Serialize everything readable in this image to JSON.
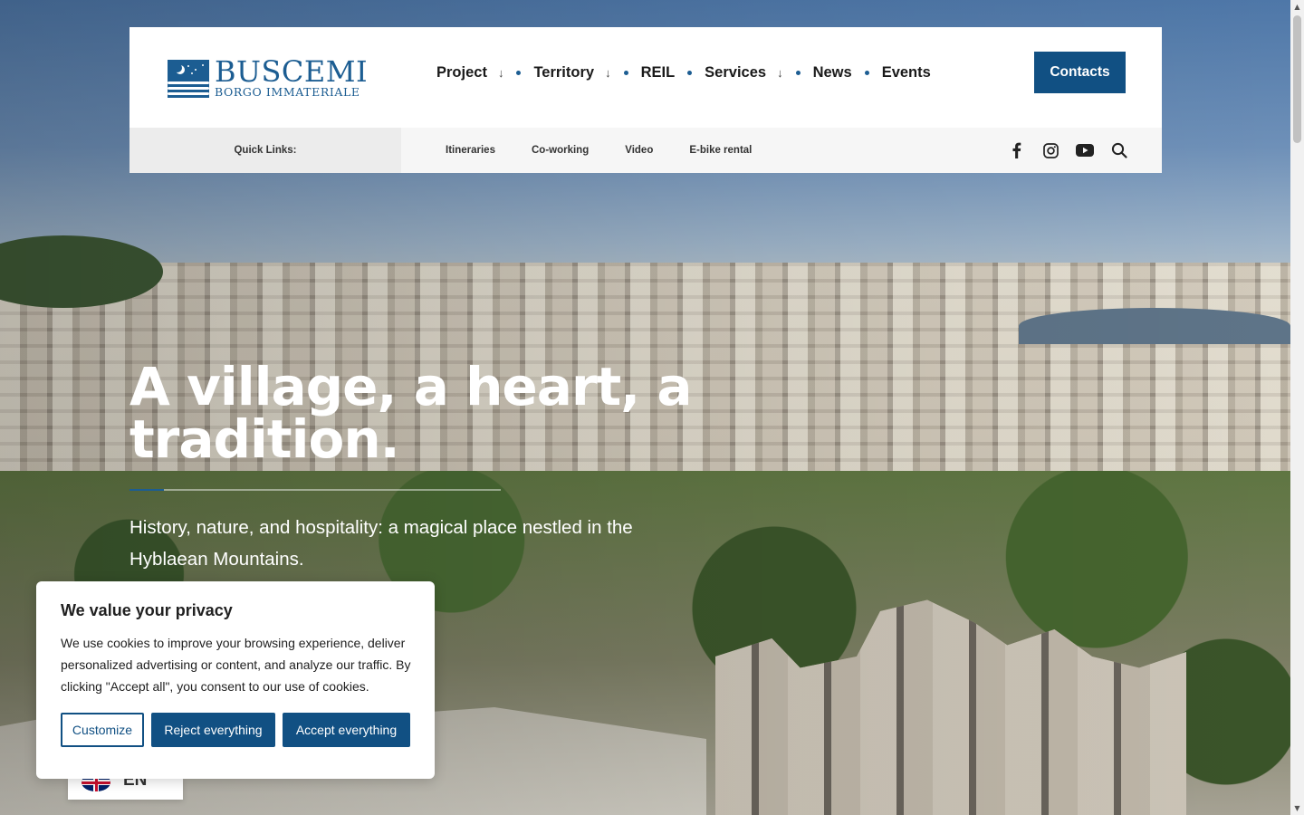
{
  "logo": {
    "title": "BUSCEMI",
    "subtitle": "BORGO IMMATERIALE"
  },
  "nav": {
    "items": [
      {
        "label": "Project",
        "has_dropdown": true
      },
      {
        "label": "Territory",
        "has_dropdown": true
      },
      {
        "label": "REIL",
        "has_dropdown": false
      },
      {
        "label": "Services",
        "has_dropdown": true
      },
      {
        "label": "News",
        "has_dropdown": false
      },
      {
        "label": "Events",
        "has_dropdown": false
      }
    ],
    "dropdown_glyph": "↓",
    "contacts_label": "Contacts"
  },
  "quick_links": {
    "label": "Quick Links:",
    "items": [
      "Itineraries",
      "Co-working",
      "Video",
      "E-bike rental"
    ]
  },
  "socials": [
    "facebook-icon",
    "instagram-icon",
    "youtube-icon",
    "search-icon"
  ],
  "hero": {
    "title": "A village, a heart, a tradition.",
    "subtitle": "History, nature, and hospitality: a magical place nestled in the Hyblaean Mountains."
  },
  "cookie": {
    "title": "We value your privacy",
    "text": "We use cookies to improve your browsing experience, deliver personalized advertising or content, and analyze our traffic. By clicking \"Accept all\", you consent to our use of cookies.",
    "customize_label": "Customize",
    "reject_label": "Reject everything",
    "accept_label": "Accept everything"
  },
  "language": {
    "code": "EN",
    "caret": "^"
  },
  "colors": {
    "brand_blue": "#115083",
    "logo_blue": "#1c5d92"
  }
}
